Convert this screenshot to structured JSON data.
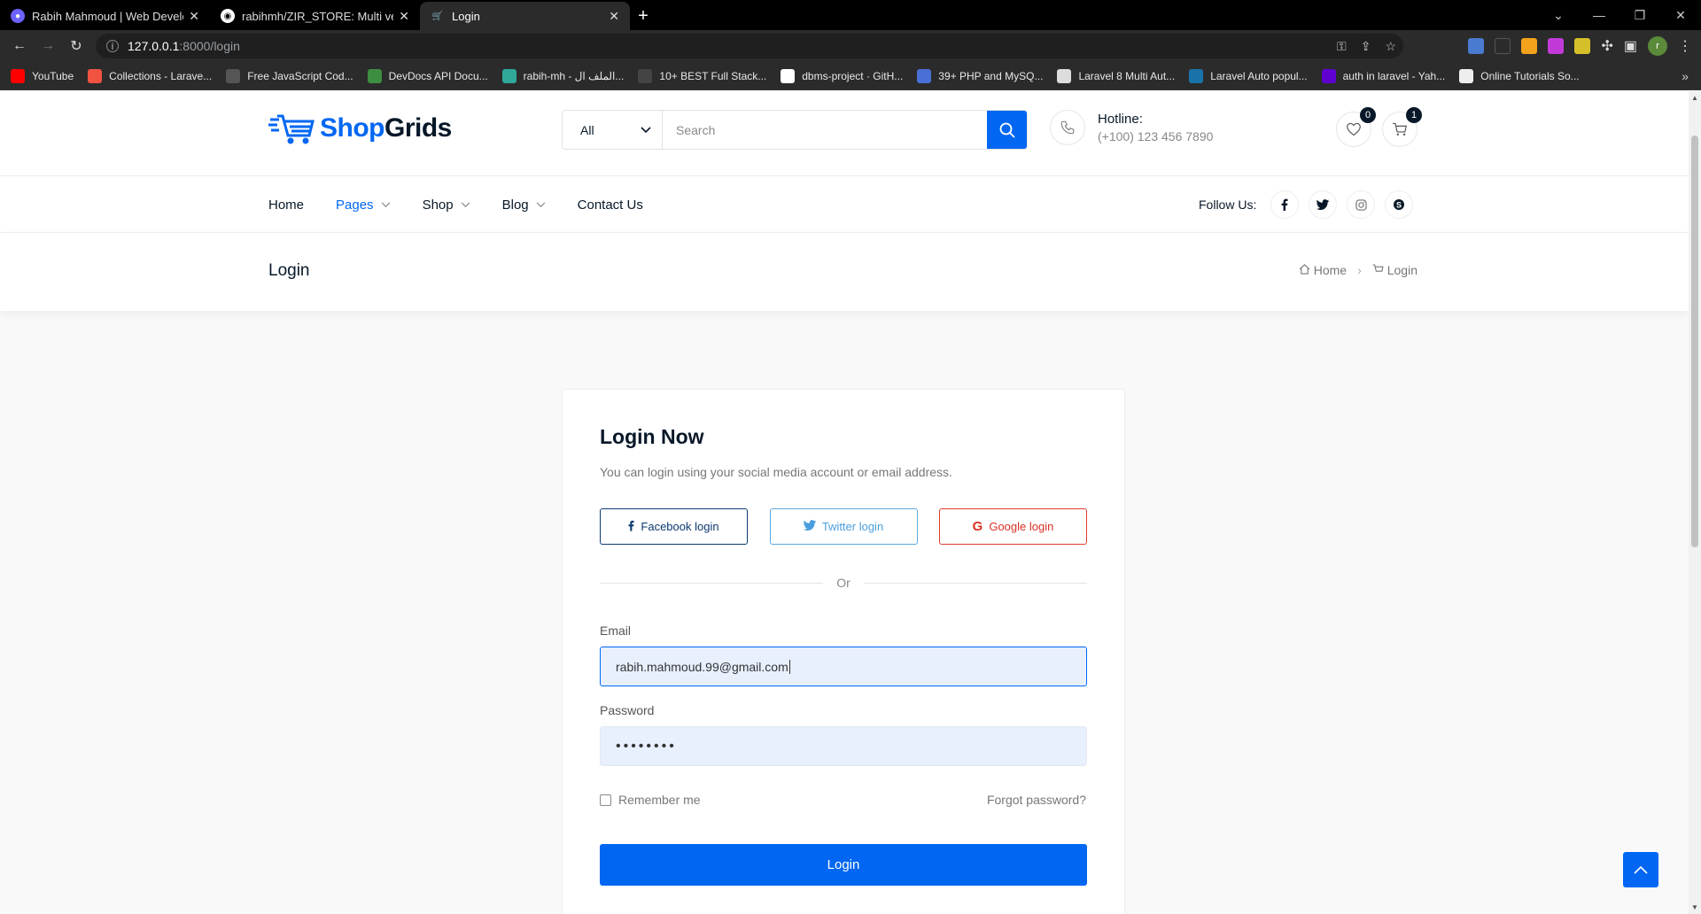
{
  "browser": {
    "tabs": [
      {
        "title": "Rabih Mahmoud | Web Develope",
        "favicon_color": "#6c63ff"
      },
      {
        "title": "rabihmh/ZIR_STORE: Multi vendo",
        "favicon_color": "#ffffff"
      },
      {
        "title": "Login",
        "favicon_color": "#0167f3"
      }
    ],
    "url_host": "127.0.0.1",
    "url_path": ":8000/login",
    "bookmarks": [
      {
        "label": "YouTube",
        "color": "#ff0000"
      },
      {
        "label": "Collections - Larave...",
        "color": "#f05340"
      },
      {
        "label": "Free JavaScript Cod...",
        "color": "#555555"
      },
      {
        "label": "DevDocs API Docu...",
        "color": "#3e8e41"
      },
      {
        "label": "rabih-mh - الملف ال...",
        "color": "#2fa89a"
      },
      {
        "label": "10+ BEST Full Stack...",
        "color": "#444444"
      },
      {
        "label": "dbms-project · GitH...",
        "color": "#ffffff"
      },
      {
        "label": "39+ PHP and MySQ...",
        "color": "#4a6fd6"
      },
      {
        "label": "Laravel 8 Multi Aut...",
        "color": "#dddddd"
      },
      {
        "label": "Laravel Auto popul...",
        "color": "#1a73a8"
      },
      {
        "label": "auth in laravel - Yah...",
        "color": "#6001d2"
      },
      {
        "label": "Online Tutorials So...",
        "color": "#eeeeee"
      }
    ],
    "profile_initial": "r"
  },
  "header": {
    "logo_shop": "Shop",
    "logo_grids": "Grids",
    "search_category": "All",
    "search_placeholder": "Search",
    "hotline_title": "Hotline:",
    "hotline_phone": "(+100) 123 456 7890",
    "wishlist_count": "0",
    "cart_count": "1"
  },
  "nav": {
    "items": [
      {
        "label": "Home",
        "dropdown": false,
        "active": false
      },
      {
        "label": "Pages",
        "dropdown": true,
        "active": true
      },
      {
        "label": "Shop",
        "dropdown": true,
        "active": false
      },
      {
        "label": "Blog",
        "dropdown": true,
        "active": false
      },
      {
        "label": "Contact Us",
        "dropdown": false,
        "active": false
      }
    ],
    "follow_label": "Follow Us:"
  },
  "breadcrumb": {
    "title": "Login",
    "home": "Home",
    "current": "Login"
  },
  "login": {
    "title": "Login Now",
    "subtitle": "You can login using your social media account or email address.",
    "facebook_label": "Facebook login",
    "twitter_label": "Twitter login",
    "google_label": "Google login",
    "or_label": "Or",
    "email_label": "Email",
    "email_value": "rabih.mahmoud.99@gmail.com",
    "password_label": "Password",
    "password_value": "••••••••",
    "remember_label": "Remember me",
    "forgot_label": "Forgot password?",
    "submit_label": "Login"
  },
  "colors": {
    "primary": "#0167f3",
    "dark": "#081828"
  }
}
